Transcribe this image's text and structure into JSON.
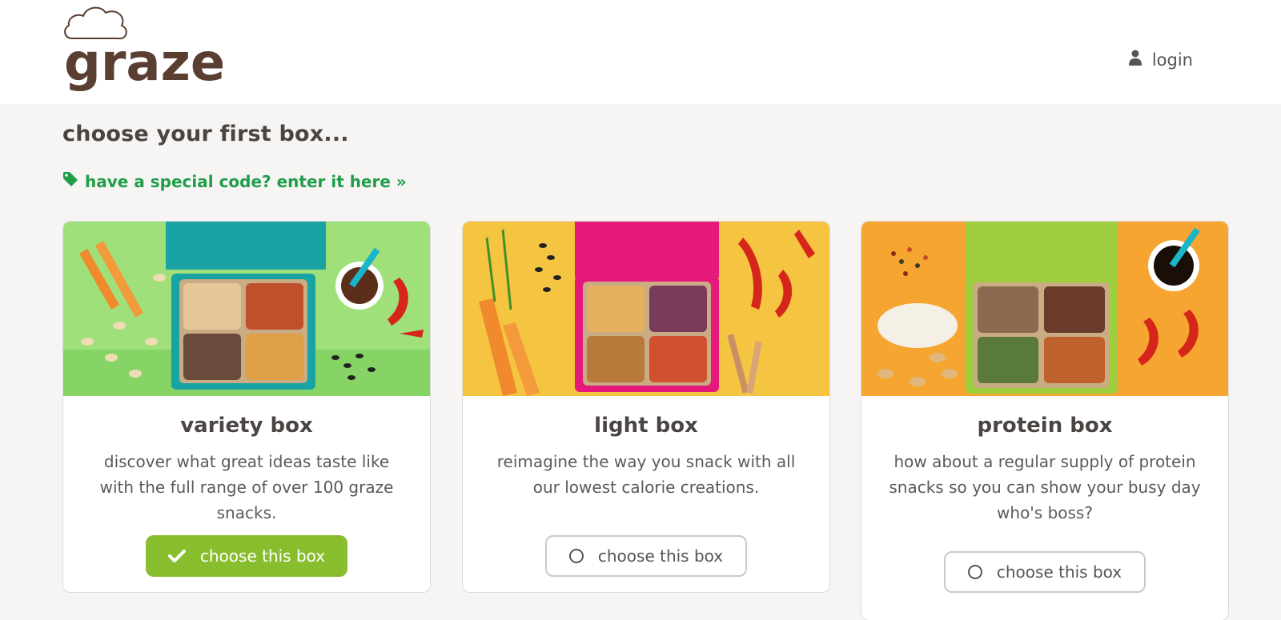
{
  "header": {
    "logo_text": "graze",
    "login_label": "login"
  },
  "page": {
    "title": "choose your first box...",
    "promo_link": "have a special code? enter it here »"
  },
  "boxes": [
    {
      "title": "variety box",
      "description": "discover what great ideas taste like with the full range of over 100 graze snacks.",
      "button_label": "choose this box",
      "selected": true,
      "image_bg": "#9fe07a",
      "box_color": "#1aa3a3"
    },
    {
      "title": "light box",
      "description": "reimagine the way you snack with all our lowest calorie creations.",
      "button_label": "choose this box",
      "selected": false,
      "image_bg": "#f5c542",
      "box_color": "#e5197a"
    },
    {
      "title": "protein box",
      "description": "how about a regular supply of protein snacks so you can show your busy day who's boss?",
      "button_label": "choose this box",
      "selected": false,
      "image_bg": "#f7a531",
      "box_color": "#9fcf3f"
    }
  ],
  "colors": {
    "accent_green": "#88be2e",
    "link_green": "#1f9d4a",
    "logo_brown": "#5a3e32"
  }
}
